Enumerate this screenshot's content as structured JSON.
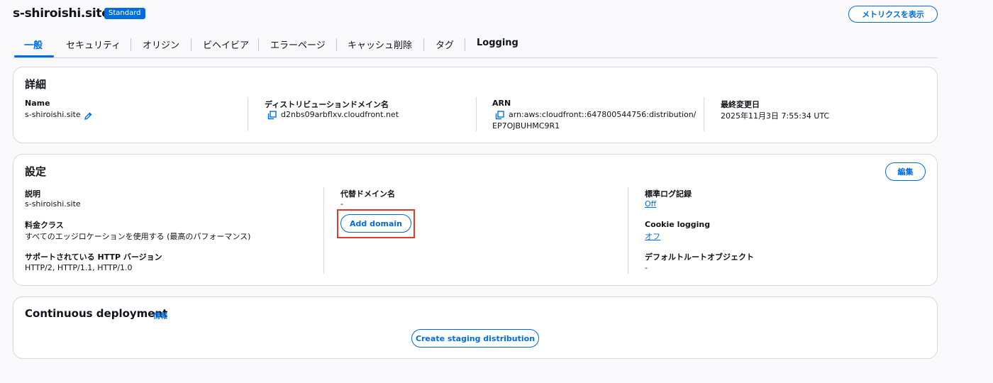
{
  "header": {
    "title": "s-shiroishi.site",
    "badge": "Standard",
    "metrics_button": "メトリクスを表示"
  },
  "tabs": [
    {
      "label": "一般",
      "active": true
    },
    {
      "label": "セキュリティ"
    },
    {
      "label": "オリジン"
    },
    {
      "label": "ビヘイビア"
    },
    {
      "label": "エラーページ"
    },
    {
      "label": "キャッシュ削除"
    },
    {
      "label": "タグ"
    },
    {
      "label": "Logging"
    }
  ],
  "details": {
    "title": "詳細",
    "name_label": "Name",
    "name_value": "s-shiroishi.site",
    "domain_label": "ディストリビューションドメイン名",
    "domain_value": "d2nbs09arbflxv.cloudfront.net",
    "arn_label": "ARN",
    "arn_value_line1": "arn:aws:cloudfront::647800544756:distribution/",
    "arn_value_line2": "EP7OJBUHMC9R1",
    "modified_label": "最終変更日",
    "modified_value": "2025年11月3日 7:55:34 UTC"
  },
  "settings": {
    "title": "設定",
    "edit_button": "編集",
    "description_label": "説明",
    "description_value": "s-shiroishi.site",
    "price_class_label": "料金クラス",
    "price_class_value": "すべてのエッジロケーションを使用する (最高のパフォーマンス)",
    "http_label": "サポートされている HTTP バージョン",
    "http_value": "HTTP/2, HTTP/1.1, HTTP/1.0",
    "alt_domain_label": "代替ドメイン名",
    "alt_domain_value": "-",
    "add_domain_button": "Add domain",
    "std_log_label": "標準ログ記録",
    "std_log_value": "Off",
    "cookie_label": "Cookie logging",
    "cookie_value": "オフ",
    "root_object_label": "デフォルトルートオブジェクト",
    "root_object_value": "-"
  },
  "continuous": {
    "title": "Continuous deployment",
    "info_link": "情報",
    "staging_button": "Create staging distribution"
  },
  "colors": {
    "accent": "#006ce0",
    "highlight": "#e03b24"
  }
}
